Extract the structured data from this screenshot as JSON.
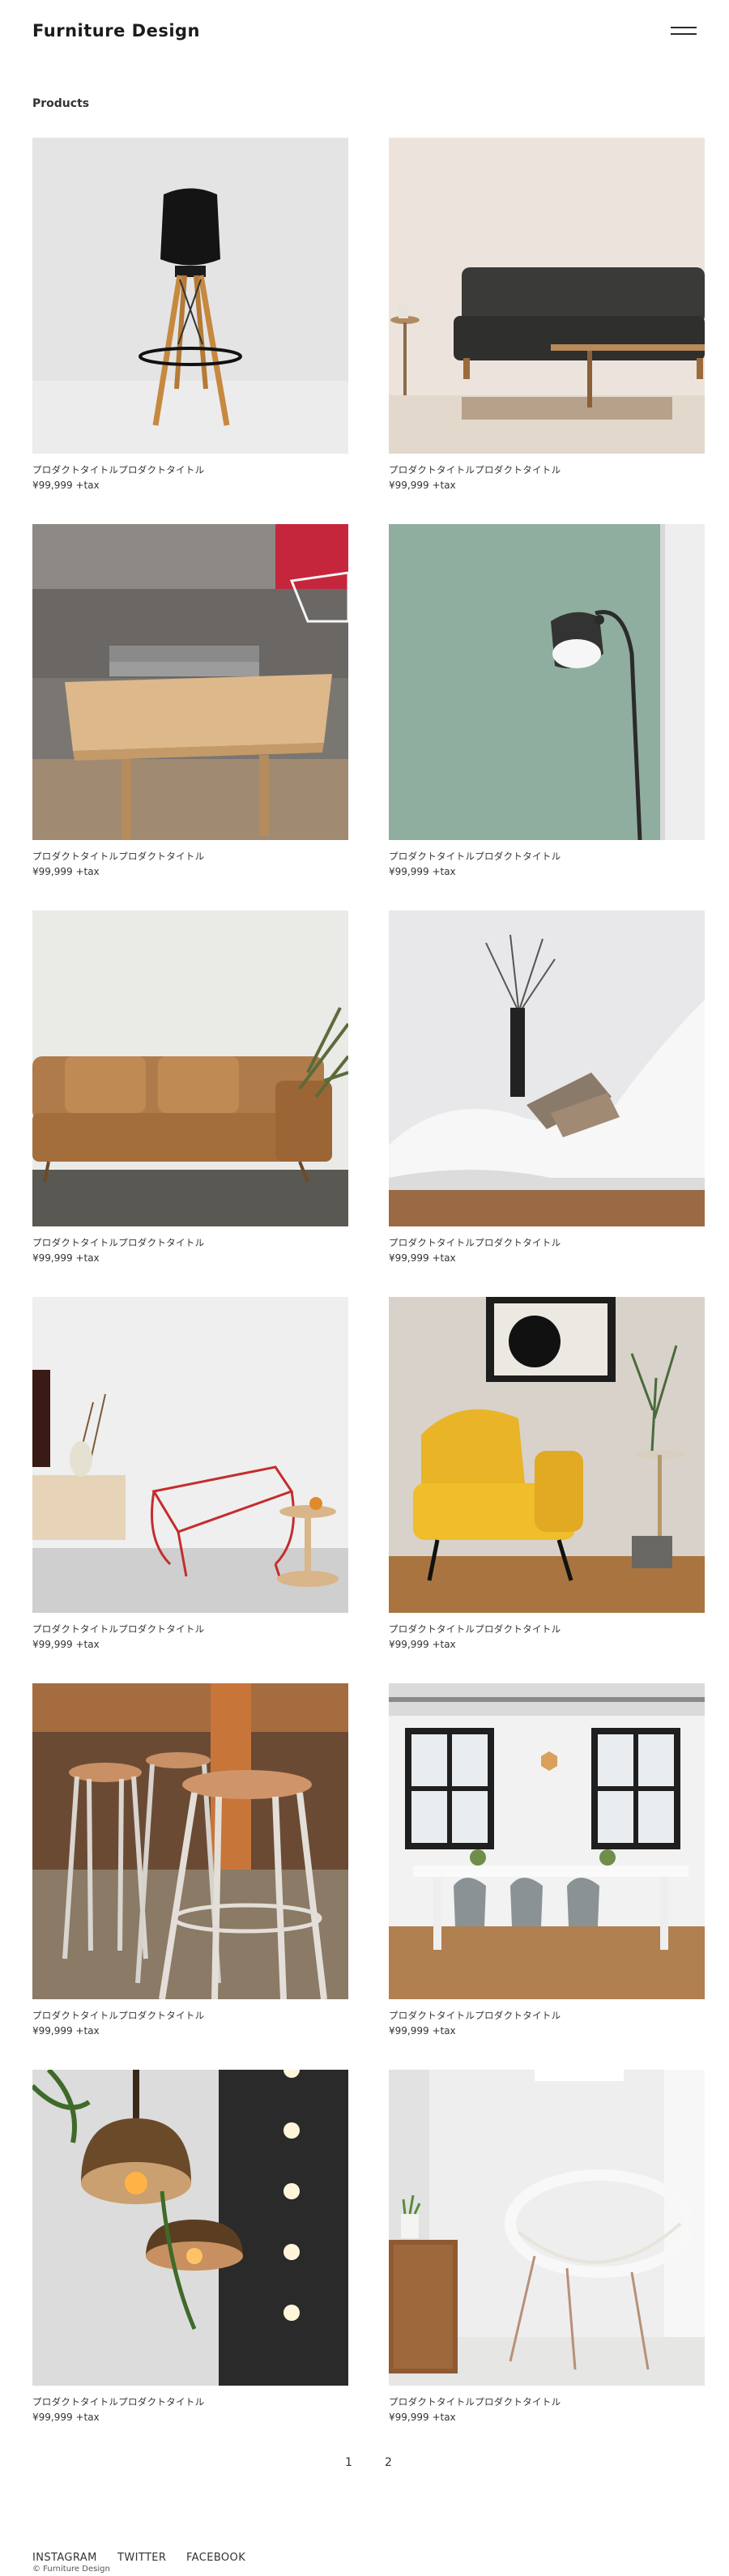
{
  "header": {
    "site_title": "Furniture Design",
    "menu_icon": "hamburger-menu-icon"
  },
  "main": {
    "section_title": "Products",
    "products": [
      {
        "title": "プロダクトタイトルプロダクトタイトル",
        "price": "¥99,999 +tax",
        "image": "black-bar-stool"
      },
      {
        "title": "プロダクトタイトルプロダクトタイトル",
        "price": "¥99,999 +tax",
        "image": "dark-grey-sofa"
      },
      {
        "title": "プロダクトタイトルプロダクトタイトル",
        "price": "¥99,999 +tax",
        "image": "wooden-side-table-with-books"
      },
      {
        "title": "プロダクトタイトルプロダクトタイトル",
        "price": "¥99,999 +tax",
        "image": "black-floor-lamp"
      },
      {
        "title": "プロダクトタイトルプロダクトタイトル",
        "price": "¥99,999 +tax",
        "image": "brown-leather-sofa"
      },
      {
        "title": "プロダクトタイトルプロダクトタイトル",
        "price": "¥99,999 +tax",
        "image": "white-chaise-lounge"
      },
      {
        "title": "プロダクトタイトルプロダクトタイトル",
        "price": "¥99,999 +tax",
        "image": "red-wire-chair"
      },
      {
        "title": "プロダクトタイトルプロダクトタイトル",
        "price": "¥99,999 +tax",
        "image": "yellow-armchair"
      },
      {
        "title": "プロダクトタイトルプロダクトタイトル",
        "price": "¥99,999 +tax",
        "image": "metal-bar-stools"
      },
      {
        "title": "プロダクトタイトルプロダクトタイトル",
        "price": "¥99,999 +tax",
        "image": "dining-room"
      },
      {
        "title": "プロダクトタイトルプロダクトタイトル",
        "price": "¥99,999 +tax",
        "image": "pendant-lamps"
      },
      {
        "title": "プロダクトタイトルプロダクトタイトル",
        "price": "¥99,999 +tax",
        "image": "white-wire-chair"
      }
    ]
  },
  "pagination": {
    "pages": [
      "1",
      "2"
    ]
  },
  "footer": {
    "links": [
      "INSTAGRAM",
      "TWITTER",
      "FACEBOOK"
    ],
    "copyright": "© Furniture Design"
  }
}
